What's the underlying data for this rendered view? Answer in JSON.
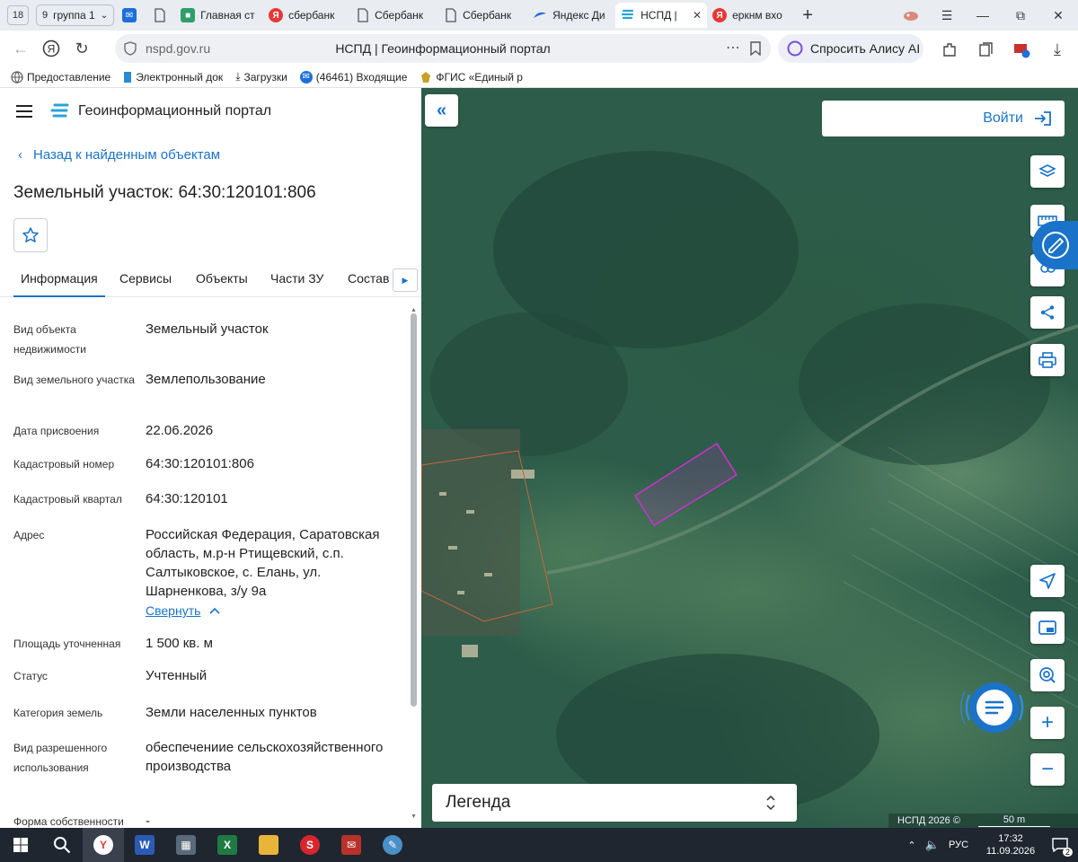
{
  "browser": {
    "tab_count": "18",
    "group": {
      "number": "9",
      "label": "группа 1"
    },
    "tabs": [
      {
        "title": "",
        "favicon": "mail-icon",
        "color": "#1e6fd9"
      },
      {
        "title": "",
        "favicon": "document-icon",
        "color": "#666666"
      },
      {
        "title": "Главная ст",
        "favicon": "gosuslugi-icon",
        "color": "#2e9e6a"
      },
      {
        "title": "сбербанк",
        "favicon": "yandex-icon",
        "color": "#e53935"
      },
      {
        "title": "Сбербанк",
        "favicon": "document-icon",
        "color": "#666666"
      },
      {
        "title": "Сбербанк",
        "favicon": "document-icon",
        "color": "#666666"
      },
      {
        "title": "Яндекс Ди",
        "favicon": "yandex-disk-icon",
        "color": "#2c6bd6"
      },
      {
        "title": "НСПД |",
        "favicon": "nspd-icon",
        "color": "#29a3d9",
        "active": true
      },
      {
        "title": "еркнм вхо",
        "favicon": "yandex-icon",
        "color": "#e53935"
      }
    ],
    "url_domain": "nspd.gov.ru",
    "page_title": "НСПД | Геоинформационный портал",
    "alice_label": "Спросить Алису AI",
    "bookmarks": [
      {
        "label": "Предоставление",
        "icon": "globe-icon"
      },
      {
        "label": "Электронный док",
        "icon": "bookmark-icon"
      },
      {
        "label": "Загрузки",
        "icon": "download-icon"
      },
      {
        "label": "(46461) Входящие",
        "icon": "mail-icon"
      },
      {
        "label": "ФГИС «Единый р",
        "icon": "emblem-icon"
      }
    ]
  },
  "portal": {
    "name": "Геоинформационный портал",
    "back_link": "Назад к найденным объектам",
    "object_title": "Земельный участок: 64:30:120101:806",
    "tabs": [
      "Информация",
      "Сервисы",
      "Объекты",
      "Части ЗУ",
      "Состав"
    ],
    "active_tab": 0,
    "properties": [
      {
        "label": "Вид объекта недвижимости",
        "value": "Земельный участок"
      },
      {
        "label": "Вид земельного участка",
        "value": "Землепользование"
      },
      {
        "label": "Дата присвоения",
        "value": "22.06.2026"
      },
      {
        "label": "Кадастровый номер",
        "value": "64:30:120101:806"
      },
      {
        "label": "Кадастровый квартал",
        "value": "64:30:120101"
      },
      {
        "label": "Адрес",
        "value": "Российская Федерация, Саратовская область, м.р-н Ртищевский, с.п. Салтыковское, с. Елань, ул. Шарненкова, з/у 9а"
      },
      {
        "label": "Площадь уточненная",
        "value": "1 500 кв. м"
      },
      {
        "label": "Статус",
        "value": "Учтенный"
      },
      {
        "label": "Категория земель",
        "value": "Земли населенных пунктов"
      },
      {
        "label": "Вид разрешенного использования",
        "value": "обеспечениие сельскохозяйственного производства"
      },
      {
        "label": "Форма собственности",
        "value": "-"
      }
    ],
    "collapse_link": "Свернуть"
  },
  "map": {
    "login_label": "Войти",
    "legend_label": "Легенда",
    "copyright": "НСПД 2026 ©",
    "scale_label": "50 m",
    "parcel_color": "#c832c8",
    "neighbor_parcel_color": "#c8643c"
  },
  "taskbar": {
    "language": "РУС",
    "time": "17:32",
    "date": "11.09.2026",
    "notifications": "2"
  }
}
